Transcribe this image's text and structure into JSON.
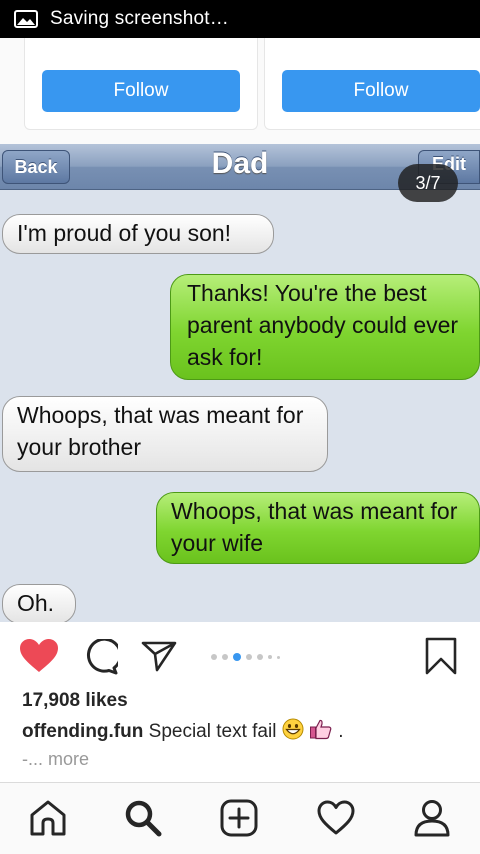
{
  "status_bar": {
    "text": "Saving screenshot…",
    "icon": "screenshot-icon"
  },
  "suggestions": {
    "cards": [
      {
        "button_label": "Follow"
      },
      {
        "button_label": "Follow"
      }
    ],
    "accent_color": "#3897f0"
  },
  "post_image": {
    "nav": {
      "back_label": "Back",
      "title": "Dad",
      "edit_label": "Edit"
    },
    "counter": "3/7",
    "messages": [
      {
        "side": "received",
        "text": "I'm proud of you son!"
      },
      {
        "side": "sent",
        "text": "Thanks! You're the best parent anybody could ever ask for!"
      },
      {
        "side": "received",
        "text": "Whoops, that was meant for your brother"
      },
      {
        "side": "sent",
        "text": "Whoops, that was meant for your wife"
      },
      {
        "side": "received",
        "text": "Oh."
      }
    ]
  },
  "actions": {
    "like_icon": "heart-filled-icon",
    "like_color": "#ed4956",
    "comment_icon": "comment-icon",
    "share_icon": "send-icon",
    "save_icon": "bookmark-icon",
    "carousel": {
      "count": 7,
      "active_index": 2
    }
  },
  "post_meta": {
    "likes": "17,908 likes",
    "username": "offending.fun",
    "caption": "Special text fail",
    "caption_emojis": [
      "grinning-face-icon",
      "thumbs-up-icon"
    ],
    "caption_tail": ".",
    "more_prefix": "-",
    "more_label": "... more"
  },
  "bottom_nav": {
    "items": [
      "home-icon",
      "search-icon",
      "new-post-icon",
      "activity-icon",
      "profile-icon"
    ]
  }
}
